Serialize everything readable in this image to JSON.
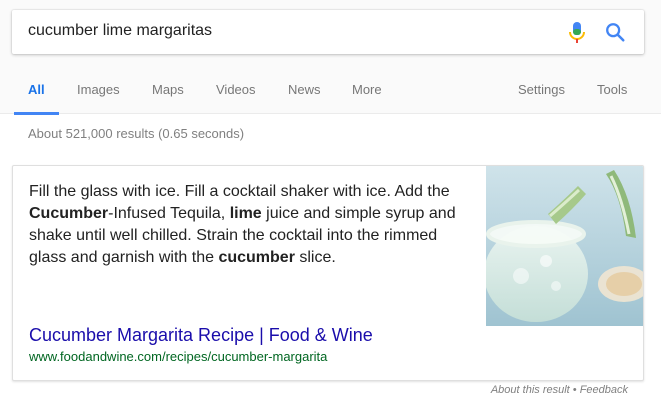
{
  "search": {
    "query": "cucumber lime margaritas",
    "mic_icon": "mic-icon",
    "search_icon": "search-icon"
  },
  "tabs": [
    {
      "label": "All",
      "active": true
    },
    {
      "label": "Images"
    },
    {
      "label": "Maps"
    },
    {
      "label": "Videos"
    },
    {
      "label": "News"
    },
    {
      "label": "More"
    }
  ],
  "tools": {
    "settings_label": "Settings",
    "tools_label": "Tools"
  },
  "result_stats": "About 521,000 results (0.65 seconds)",
  "featured_snippet": {
    "text_parts": [
      "Fill the glass with ice. Fill a cocktail shaker with ice. Add the ",
      "Cucumber",
      "-Infused Tequila, ",
      "lime",
      " juice and simple syrup and shake until well chilled. Strain the cocktail into the rimmed glass and garnish with the ",
      "cucumber",
      " slice."
    ],
    "link_title": "Cucumber Margarita Recipe | Food & Wine",
    "link_url": "www.foodandwine.com/recipes/cucumber-margarita",
    "image_alt": "cucumber margarita cocktail"
  },
  "footer": {
    "about": "About this result",
    "separator": " • ",
    "feedback": "Feedback"
  },
  "colors": {
    "link": "#1a0dab",
    "url": "#006621",
    "accent": "#4285f4"
  }
}
